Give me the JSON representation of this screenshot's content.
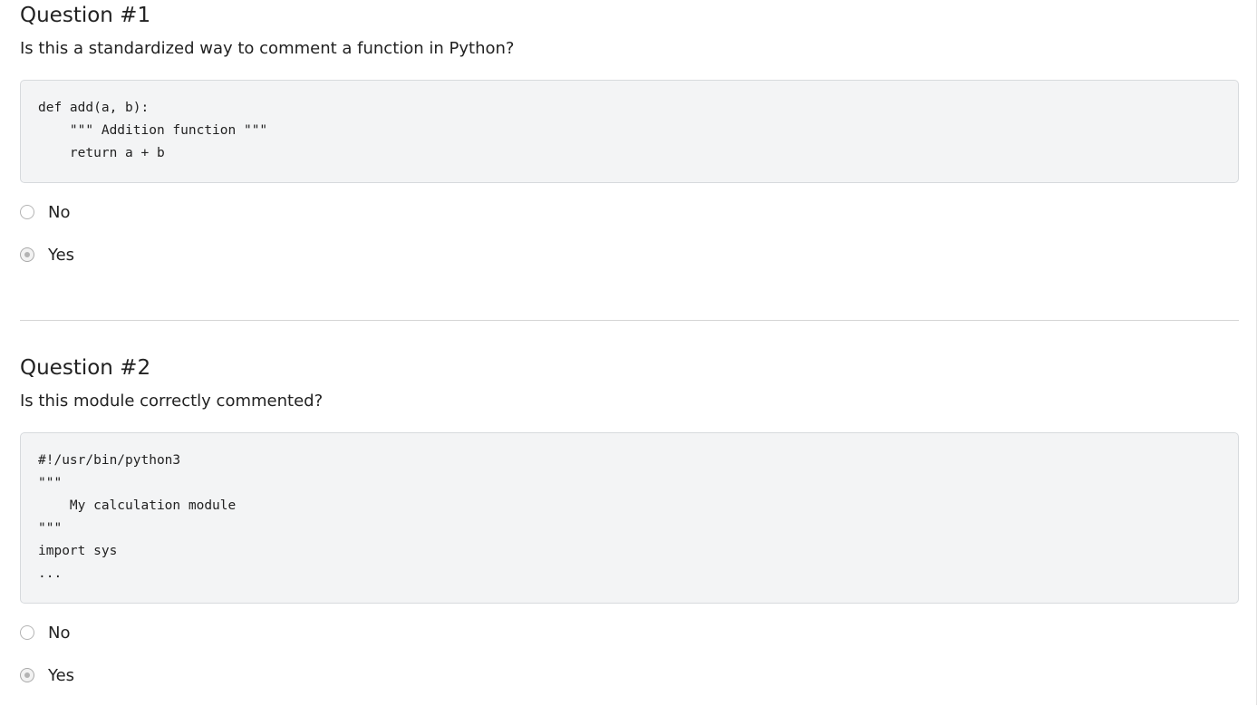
{
  "questions": [
    {
      "title": "Question #1",
      "prompt": "Is this a standardized way to comment a function in Python?",
      "code": [
        "def add(a, b):",
        "    \"\"\" Addition function \"\"\"",
        "    return a + b"
      ],
      "options": [
        {
          "label": "No",
          "selected": false
        },
        {
          "label": "Yes",
          "selected": true
        }
      ]
    },
    {
      "title": "Question #2",
      "prompt": "Is this module correctly commented?",
      "code": [
        "#!/usr/bin/python3",
        "\"\"\"",
        "    My calculation module",
        "\"\"\"",
        "import sys",
        "..."
      ],
      "options": [
        {
          "label": "No",
          "selected": false
        },
        {
          "label": "Yes",
          "selected": true
        }
      ]
    }
  ]
}
